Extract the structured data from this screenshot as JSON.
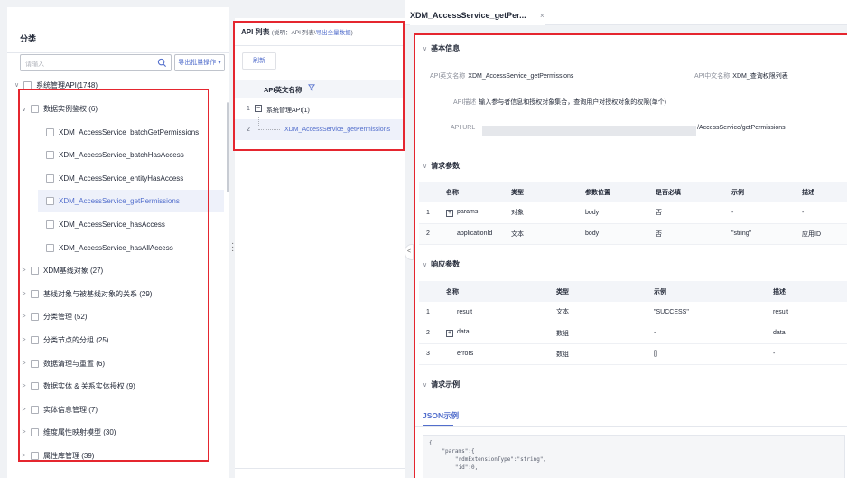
{
  "category": {
    "title": "分类",
    "search_placeholder": "请输入",
    "batch_button": "导出批量操作",
    "root": "系统管理API(1748)",
    "items": [
      {
        "label": "数据实例鉴权 (6)",
        "expanded": true
      },
      {
        "label": "XDM_AccessService_batchGetPermissions",
        "child": true
      },
      {
        "label": "XDM_AccessService_batchHasAccess",
        "child": true
      },
      {
        "label": "XDM_AccessService_entityHasAccess",
        "child": true
      },
      {
        "label": "XDM_AccessService_getPermissions",
        "child": true,
        "selected": true
      },
      {
        "label": "XDM_AccessService_hasAccess",
        "child": true
      },
      {
        "label": "XDM_AccessService_hasAllAccess",
        "child": true
      },
      {
        "label": "XDM基线对象 (27)"
      },
      {
        "label": "基线对象与被基线对象的关系 (29)"
      },
      {
        "label": "分类管理 (52)"
      },
      {
        "label": "分类节点的分组 (25)"
      },
      {
        "label": "数据清理与重置 (6)"
      },
      {
        "label": "数据实体 & 关系实体授权 (9)"
      },
      {
        "label": "实体信息管理 (7)"
      },
      {
        "label": "维度属性映射模型 (30)"
      },
      {
        "label": "属性库管理 (39)"
      }
    ]
  },
  "api_list": {
    "title": "API 列表",
    "note": "(说明：API 列表\\",
    "export_link": "导出全量数据",
    "note_end": ")",
    "refresh": "刷新",
    "column": "API英文名称",
    "rows": [
      {
        "num": "1",
        "label": "系统管理API(1)",
        "toggle": "−"
      },
      {
        "num": "2",
        "label": "XDM_AccessService_getPermissions"
      }
    ]
  },
  "detail": {
    "tab_title": "XDM_AccessService_getPer...",
    "tab_close": "×",
    "basic_title": "基本信息",
    "api_en_name_label": "API英文名称",
    "api_en_name": "XDM_AccessService_getPermissions",
    "api_cn_name_label": "API中文名称",
    "api_cn_name": "XDM_查询权限列表",
    "api_desc_label": "API描述",
    "api_desc": "输入参与者信息和授权对象集合，查询用户对授权对象的权限(单个)",
    "api_url_label": "API URL",
    "api_url": "/AccessService/getPermissions",
    "req_params_title": "请求参数",
    "req_columns": [
      "名称",
      "类型",
      "参数位置",
      "是否必填",
      "示例",
      "描述"
    ],
    "req_rows": [
      [
        "1",
        "params",
        "对象",
        "body",
        "否",
        "-",
        "-"
      ],
      [
        "2",
        "applicationId",
        "文本",
        "body",
        "否",
        "\"string\"",
        "应用ID"
      ]
    ],
    "resp_params_title": "响应参数",
    "resp_columns": [
      "名称",
      "类型",
      "示例",
      "描述"
    ],
    "resp_rows": [
      [
        "1",
        "result",
        "文本",
        "\"SUCCESS\"",
        "result"
      ],
      [
        "2",
        "data",
        "数组",
        "-",
        "data"
      ],
      [
        "3",
        "errors",
        "数组",
        "[]",
        "-"
      ]
    ],
    "req_example_title": "请求示例",
    "json_tab": "JSON示例",
    "code": "{\n    \"params\":{\n        \"rdmExtensionType\":\"string\",\n        \"id\":0,"
  },
  "colors": {
    "accent": "#526ecc",
    "highlight": "#e5262f",
    "selected_bg": "#eef1fa"
  }
}
